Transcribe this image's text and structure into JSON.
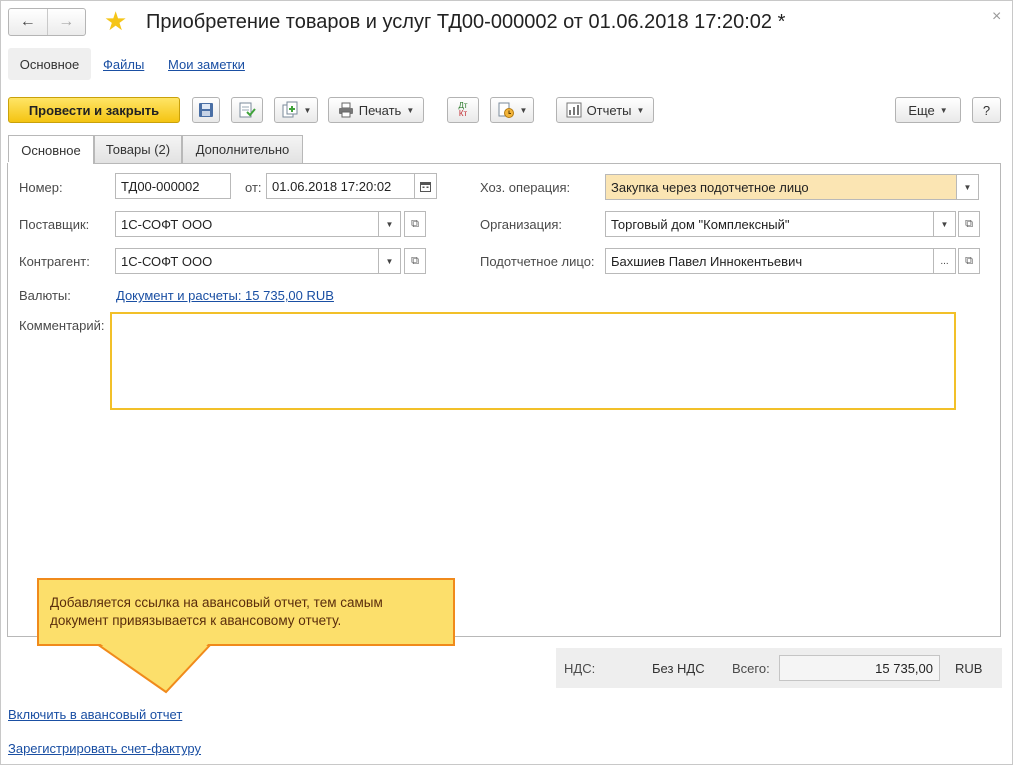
{
  "window": {
    "title": "Приобретение товаров и услуг ТД00-000002 от 01.06.2018 17:20:02 *",
    "back_icon": "←",
    "forward_icon": "→",
    "star_icon": "★",
    "close_icon": "×"
  },
  "top_tabs": {
    "main": "Основное",
    "files": "Файлы",
    "notes": "Мои заметки"
  },
  "toolbar": {
    "post_close": "Провести и закрыть",
    "print": "Печать",
    "reports": "Отчеты",
    "more": "Еще",
    "help": "?",
    "dtkt_top": "Дт",
    "dtkt_bottom": "Кт"
  },
  "inner_tabs": {
    "main": "Основное",
    "goods": "Товары (2)",
    "additional": "Дополнительно"
  },
  "form": {
    "number_label": "Номер:",
    "number_value": "ТД00-000002",
    "date_label": "от:",
    "date_value": "01.06.2018 17:20:02",
    "supplier_label": "Поставщик:",
    "supplier_value": "1С-СОФТ ООО",
    "counterparty_label": "Контрагент:",
    "counterparty_value": "1С-СОФТ ООО",
    "currency_label": "Валюты:",
    "currency_link": "Документ и расчеты: 15 735,00 RUB",
    "comment_label": "Комментарий:",
    "comment_value": "",
    "operation_label": "Хоз. операция:",
    "operation_value": "Закупка через подотчетное лицо",
    "organization_label": "Организация:",
    "organization_value": "Торговый дом \"Комплексный\"",
    "accountable_label": "Подотчетное лицо:",
    "accountable_value": "Бахшиев Павел Иннокентьевич",
    "ellipsis": "..."
  },
  "totals": {
    "vat_label": "НДС:",
    "vat_value": "Без НДС",
    "total_label": "Всего:",
    "total_value": "15 735,00",
    "currency": "RUB"
  },
  "bottom_links": {
    "include_advance": "Включить в авансовый отчет",
    "register_invoice": "Зарегистрировать счет-фактуру"
  },
  "callout": {
    "text": "Добавляется ссылка на авансовый отчет, тем самым документ привязывается к авансовому отчету."
  },
  "colors": {
    "primary_button": "#f4c412",
    "highlight_field": "#fbe5b3",
    "callout_fill": "#fcdf6b",
    "callout_border": "#f08a1b",
    "link": "#1a4fa3",
    "comment_border": "#f2c029"
  }
}
